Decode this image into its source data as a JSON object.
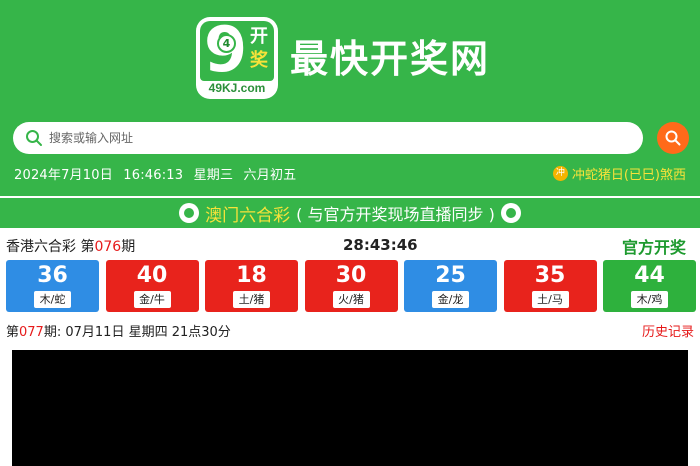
{
  "header": {
    "logo": {
      "nine": "9",
      "ball": "4",
      "kai": "开",
      "jiang": "奖",
      "domain": "49KJ.com"
    },
    "site_title": "最快开奖网",
    "search": {
      "placeholder": "搜索或输入网址",
      "value": ""
    },
    "datetime": {
      "date": "2024年7月10日",
      "time": "16:46:13",
      "weekday": "星期三",
      "lunar": "六月初五"
    },
    "almanac": {
      "icon": "冲",
      "text": "冲蛇猪日(已巳)煞西"
    }
  },
  "banner": {
    "title": "澳门六合彩",
    "subtitle": "( 与官方开奖现场直播同步 )"
  },
  "draw": {
    "lottery_name": "香港六合彩 第",
    "issue": "076",
    "issue_suffix": "期",
    "countdown": "28:43:46",
    "official_label": "官方开奖",
    "balls": [
      {
        "number": "36",
        "zodiac": "木/蛇",
        "color": "#2f8de4"
      },
      {
        "number": "40",
        "zodiac": "金/牛",
        "color": "#e8231c"
      },
      {
        "number": "18",
        "zodiac": "土/猪",
        "color": "#e8231c"
      },
      {
        "number": "30",
        "zodiac": "火/猪",
        "color": "#e8231c"
      },
      {
        "number": "25",
        "zodiac": "金/龙",
        "color": "#2f8de4"
      },
      {
        "number": "35",
        "zodiac": "土/马",
        "color": "#e8231c"
      },
      {
        "number": "44",
        "zodiac": "木/鸡",
        "color": "#2eb13d"
      }
    ],
    "next": {
      "prefix": "第",
      "issue": "077",
      "suffix": "期:  07月11日 星期四 21点30分"
    },
    "history_label": "历史记录"
  }
}
